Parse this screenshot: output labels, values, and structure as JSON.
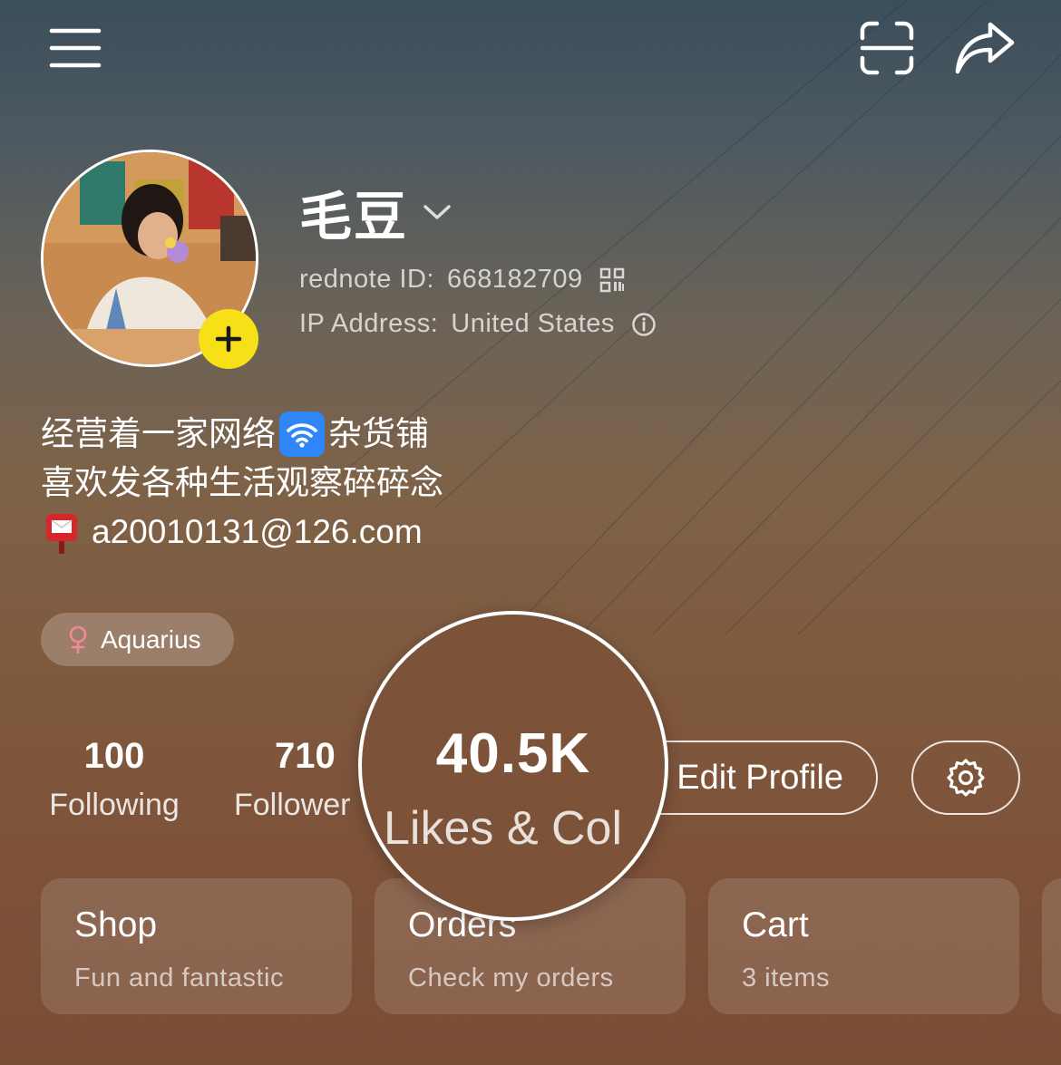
{
  "profile": {
    "name": "毛豆",
    "id_label": "rednote ID:",
    "id_value": "668182709",
    "ip_label": "IP Address:",
    "ip_value": "United States",
    "bio": {
      "line1_part1": "经营着一家网络",
      "line1_part2": "杂货铺",
      "line2": "喜欢发各种生活观察碎碎念",
      "line3": "a20010131@126.com"
    },
    "tag": "Aquarius"
  },
  "stats": {
    "following": {
      "value": "100",
      "label": "Following"
    },
    "followers": {
      "value": "710",
      "label": "Follower"
    },
    "likes": {
      "value": "40.5K",
      "label": "Likes & Col"
    }
  },
  "actions": {
    "edit_profile": "Edit Profile"
  },
  "cards": [
    {
      "title": "Shop",
      "subtitle": "Fun and fantastic"
    },
    {
      "title": "Orders",
      "subtitle": "Check my orders"
    },
    {
      "title": "Cart",
      "subtitle": "3 items"
    }
  ],
  "colors": {
    "badge": "#f7e017",
    "tag_female_icon": "#f08a94",
    "wifi_emoji_bg": "#2f86f6"
  },
  "icons": [
    "menu-icon",
    "scan-icon",
    "share-icon",
    "plus-icon",
    "chevron-down-icon",
    "qr-code-icon",
    "info-icon",
    "wifi-emoji-icon",
    "mailbox-emoji-icon",
    "female-icon",
    "gear-icon"
  ]
}
